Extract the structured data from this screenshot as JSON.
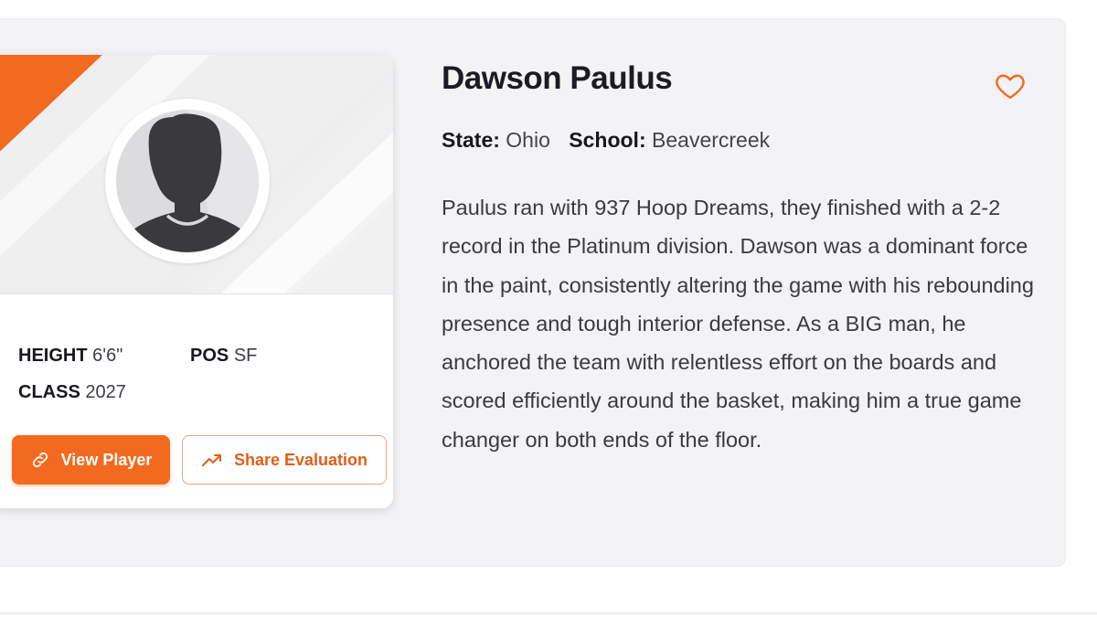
{
  "player": {
    "name": "Dawson Paulus",
    "state_label": "State:",
    "state_value": "Ohio",
    "school_label": "School:",
    "school_value": "Beavercreek",
    "bio": "Paulus ran with 937 Hoop Dreams, they finished with a 2-2 record in the Platinum division. Dawson was a dominant force in the paint, consistently altering the game with his rebounding presence and tough interior defense. As a BIG man, he anchored the team with relentless effort on the boards and scored efficiently around the basket, making him a true game changer on both ends of the floor."
  },
  "stats": {
    "height_label": "HEIGHT",
    "height_value": "6'6\"",
    "pos_label": "POS",
    "pos_value": "SF",
    "class_label": "CLASS",
    "class_value": "2027"
  },
  "actions": {
    "view_player": "View Player",
    "share_evaluation": "Share Evaluation"
  },
  "icons": {
    "favorite": "heart-outline-icon",
    "view": "link-icon",
    "share": "trending-up-icon",
    "avatar": "person-silhouette-icon"
  },
  "colors": {
    "accent": "#f26a1f",
    "outline_text": "#e05f18",
    "card_background": "#f3f2f5"
  }
}
